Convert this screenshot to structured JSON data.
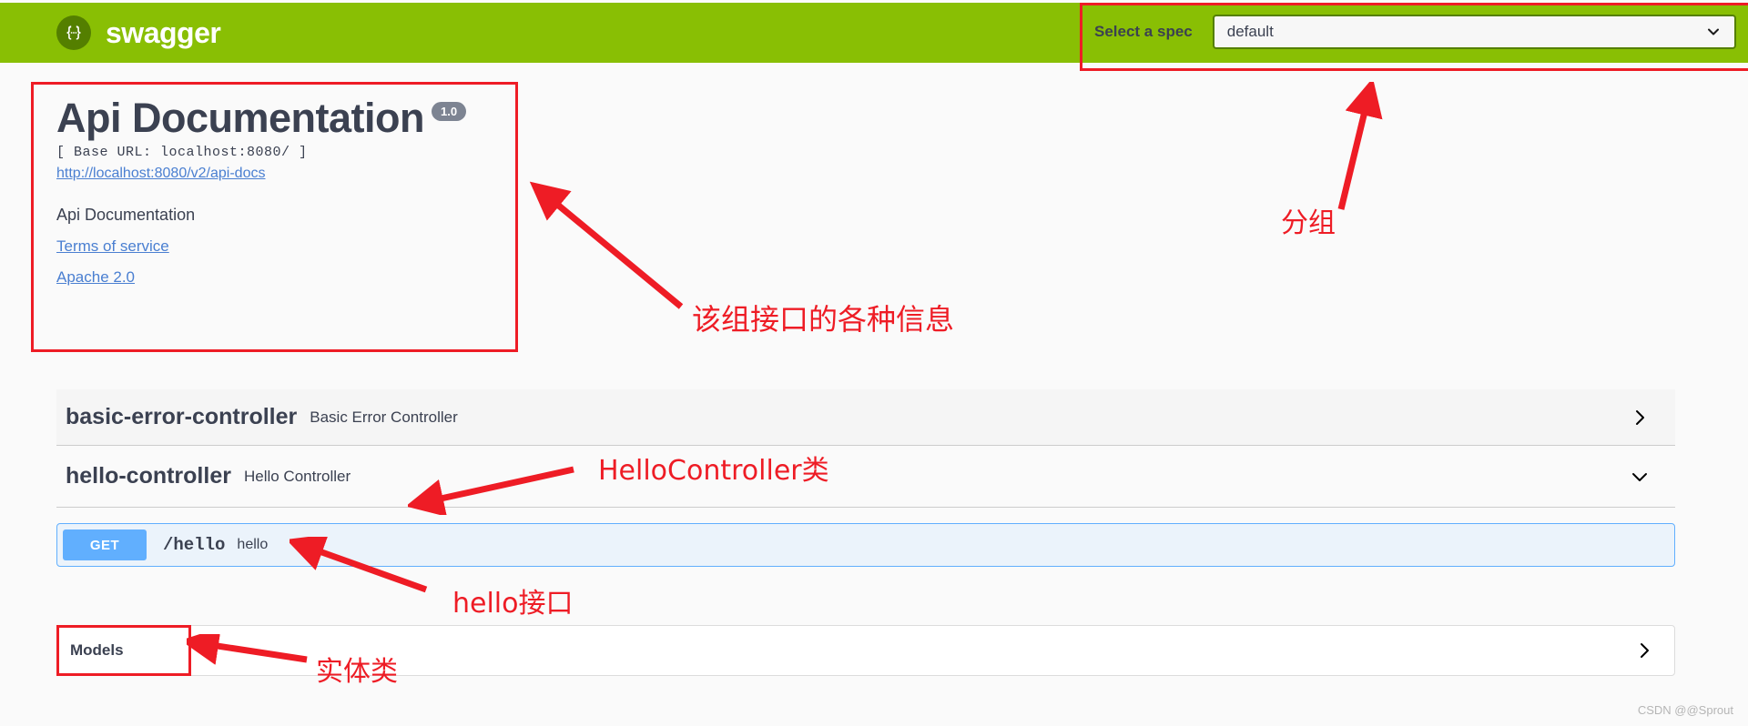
{
  "topbar": {
    "logo_text": "swagger",
    "logo_glyph": "{…}",
    "spec_label": "Select a spec",
    "spec_value": "default",
    "bg_color": "#89bf04"
  },
  "info": {
    "title": "Api Documentation",
    "version": "1.0",
    "base_url": "[ Base URL: localhost:8080/ ]",
    "docs_link": "http://localhost:8080/v2/api-docs",
    "description": "Api Documentation",
    "terms_link": "Terms of service",
    "license_link": "Apache 2.0"
  },
  "tags": [
    {
      "name": "basic-error-controller",
      "description": "Basic Error Controller",
      "expanded": false,
      "arrow": "chevron-right-icon"
    },
    {
      "name": "hello-controller",
      "description": "Hello Controller",
      "expanded": true,
      "arrow": "chevron-down-icon"
    }
  ],
  "operations": [
    {
      "method": "GET",
      "path": "/hello",
      "summary": "hello",
      "method_color": "#61affe"
    }
  ],
  "models": {
    "label": "Models",
    "arrow": "chevron-right-icon"
  },
  "annotations": {
    "color": "#ee1c25",
    "group": "分组",
    "info_block": "该组接口的各种信息",
    "hello_controller_class": "HelloController类",
    "hello_interface": "hello接口",
    "models_entity": "实体类"
  },
  "watermark": "CSDN @@Sprout"
}
